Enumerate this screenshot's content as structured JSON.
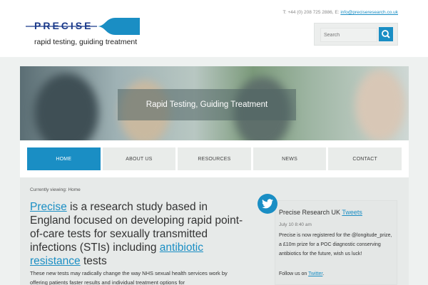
{
  "header": {
    "logo": {
      "word": "PRECISE",
      "tagline": "rapid testing, guiding treatment"
    },
    "contact": {
      "phone_prefix": "T: +44 (0) 208 725 2886",
      "email_prefix": "E:",
      "email": "info@preciseresearch.co.uk"
    },
    "search": {
      "placeholder": "Search"
    }
  },
  "hero": {
    "caption": "Rapid Testing, Guiding Treatment"
  },
  "nav": {
    "items": [
      {
        "label": "HOME",
        "active": true
      },
      {
        "label": "ABOUT US"
      },
      {
        "label": "RESOURCES"
      },
      {
        "label": "NEWS"
      },
      {
        "label": "CONTACT"
      }
    ]
  },
  "main": {
    "breadcrumb": "Currently viewing: Home",
    "lead": {
      "link1": "Precise",
      "text1": " is a research study based in England focused on developing rapid point-of-care tests for sexually transmitted infections (STIs) including ",
      "link2": "antibiotic resistance",
      "text2": " tests"
    },
    "body": "These new tests may radically change the way NHS sexual health services work by offering patients faster results and individual treatment options for"
  },
  "twitter": {
    "title_prefix": "Precise Research UK",
    "title_link": "Tweets",
    "date": "July 10 8:40 am",
    "text": "Precise is now registered for the @longitude_prize, a £10m prize for a POC diagnostic conserving antibiotics for the future, wish us luck!",
    "follow_prefix": "Follow us on",
    "follow_link": "Twitter",
    "follow_suffix": "."
  },
  "colors": {
    "accent": "#1a8ec4",
    "logo_navy": "#1b3a8a"
  }
}
